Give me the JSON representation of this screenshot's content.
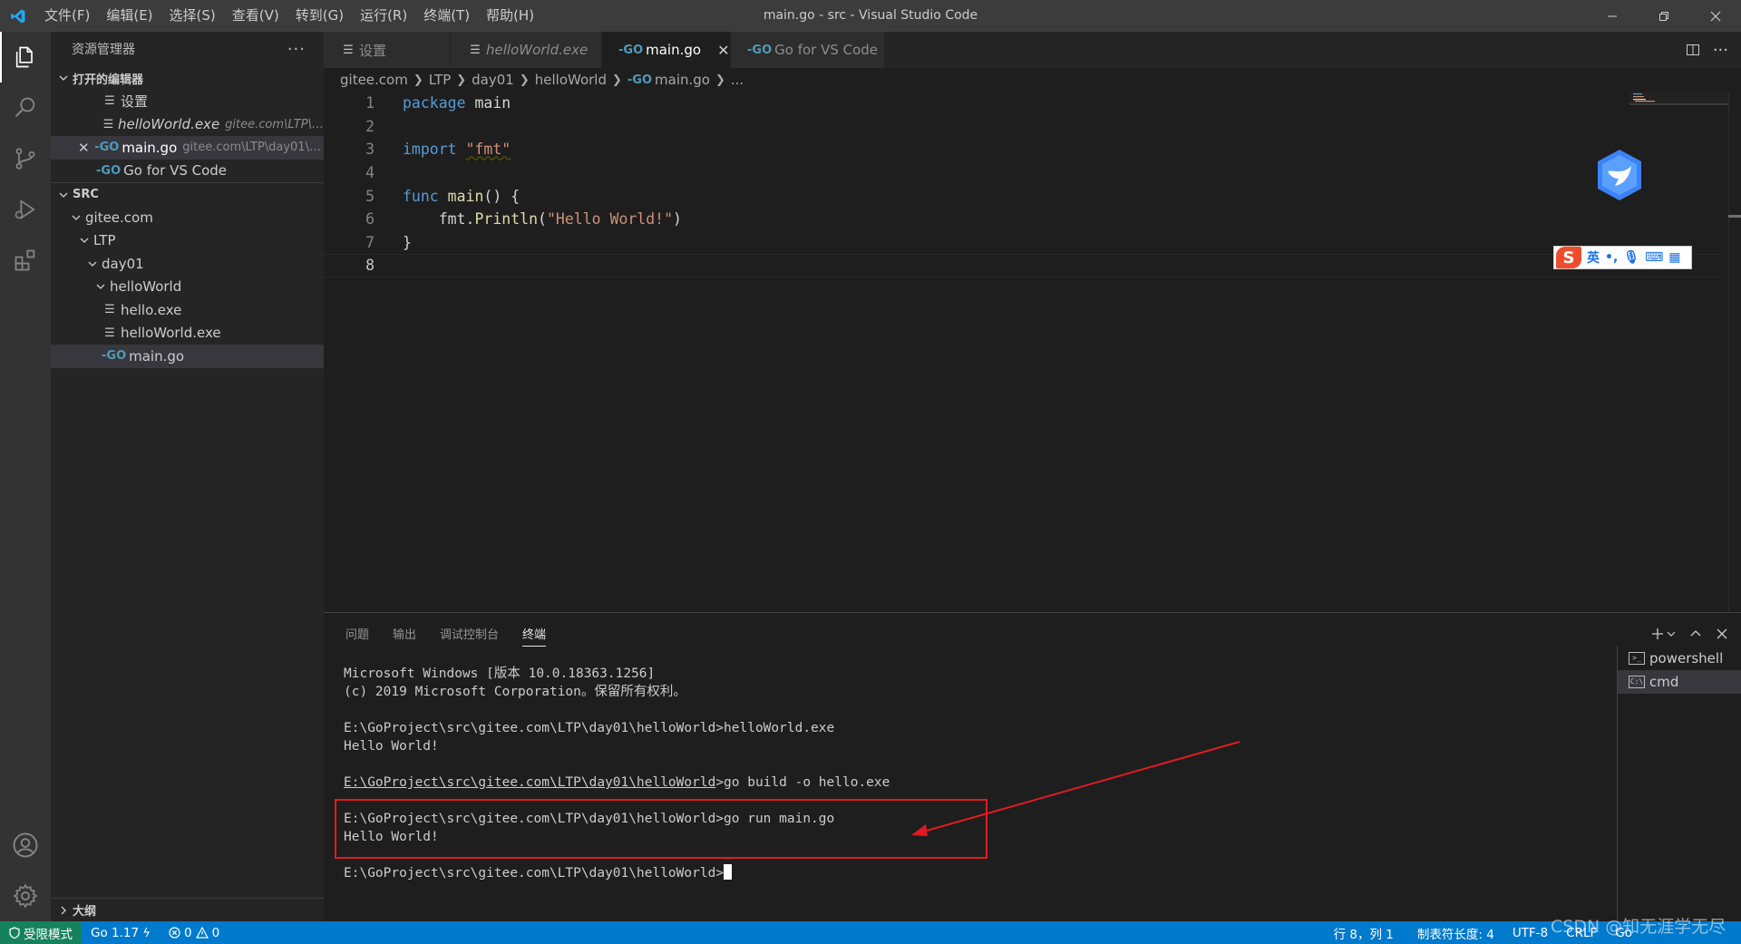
{
  "titlebar": {
    "title": "main.go - src - Visual Studio Code",
    "menu": [
      "文件(F)",
      "编辑(E)",
      "选择(S)",
      "查看(V)",
      "转到(G)",
      "运行(R)",
      "终端(T)",
      "帮助(H)"
    ]
  },
  "sidebar": {
    "header": "资源管理器",
    "open_editors_label": "打开的编辑器",
    "open_editors": [
      {
        "name": "设置",
        "desc": ""
      },
      {
        "name": "helloWorld.exe",
        "desc": "gitee.com\\LTP\\day..."
      },
      {
        "name": "main.go",
        "desc": "gitee.com\\LTP\\day01\\hell..."
      },
      {
        "name": "Go for VS Code",
        "desc": ""
      }
    ],
    "folder_label": "SRC",
    "tree": [
      "gitee.com",
      "LTP",
      "day01",
      "helloWorld",
      "hello.exe",
      "helloWorld.exe",
      "main.go"
    ],
    "outline_label": "大纲"
  },
  "tabs": [
    {
      "label": "设置"
    },
    {
      "label": "helloWorld.exe"
    },
    {
      "label": "main.go"
    },
    {
      "label": "Go for VS Code"
    }
  ],
  "breadcrumb": [
    "gitee.com",
    "LTP",
    "day01",
    "helloWorld",
    "main.go",
    "..."
  ],
  "code": {
    "line_numbers": [
      "1",
      "2",
      "3",
      "4",
      "5",
      "6",
      "7",
      "8"
    ],
    "kw_package": "package",
    "pkg_name": " main",
    "kw_import": "import",
    "import_path": "\"fmt\"",
    "kw_func": "func",
    "func_name": " main",
    "func_rest": "() {",
    "call_prefix": "    fmt.",
    "call_fn": "Println",
    "call_open": "(",
    "call_arg": "\"Hello World!\"",
    "call_close": ")",
    "close_brace": "}"
  },
  "ime": {
    "lang": "英"
  },
  "panel": {
    "tabs": [
      "问题",
      "输出",
      "调试控制台",
      "终端"
    ],
    "terminal_lines": [
      "Microsoft Windows [版本 10.0.18363.1256]",
      "(c) 2019 Microsoft Corporation。保留所有权利。",
      "",
      "E:\\GoProject\\src\\gitee.com\\LTP\\day01\\helloWorld>helloWorld.exe",
      "Hello World!",
      "",
      "E:\\GoProject\\src\\gitee.com\\LTP\\day01\\helloWorld",
      ">go build -o hello.exe",
      "",
      "E:\\GoProject\\src\\gitee.com\\LTP\\day01\\helloWorld>go run main.go",
      "Hello World!",
      "",
      "E:\\GoProject\\src\\gitee.com\\LTP\\day01\\helloWorld>"
    ],
    "terminals": [
      "powershell",
      "cmd"
    ]
  },
  "statusbar": {
    "restricted": "受限模式",
    "go_version": "Go 1.17",
    "errors": "0",
    "warnings": "0",
    "position": "行 8，列 1",
    "tab_size": "制表符长度: 4",
    "encoding": "UTF-8",
    "eol": "CRLF",
    "language": "Go"
  },
  "watermark": "CSDN @知无涯学无尽",
  "colors": {
    "accent": "#007acc",
    "restricted": "#16825d",
    "annotation": "#e11b22"
  }
}
